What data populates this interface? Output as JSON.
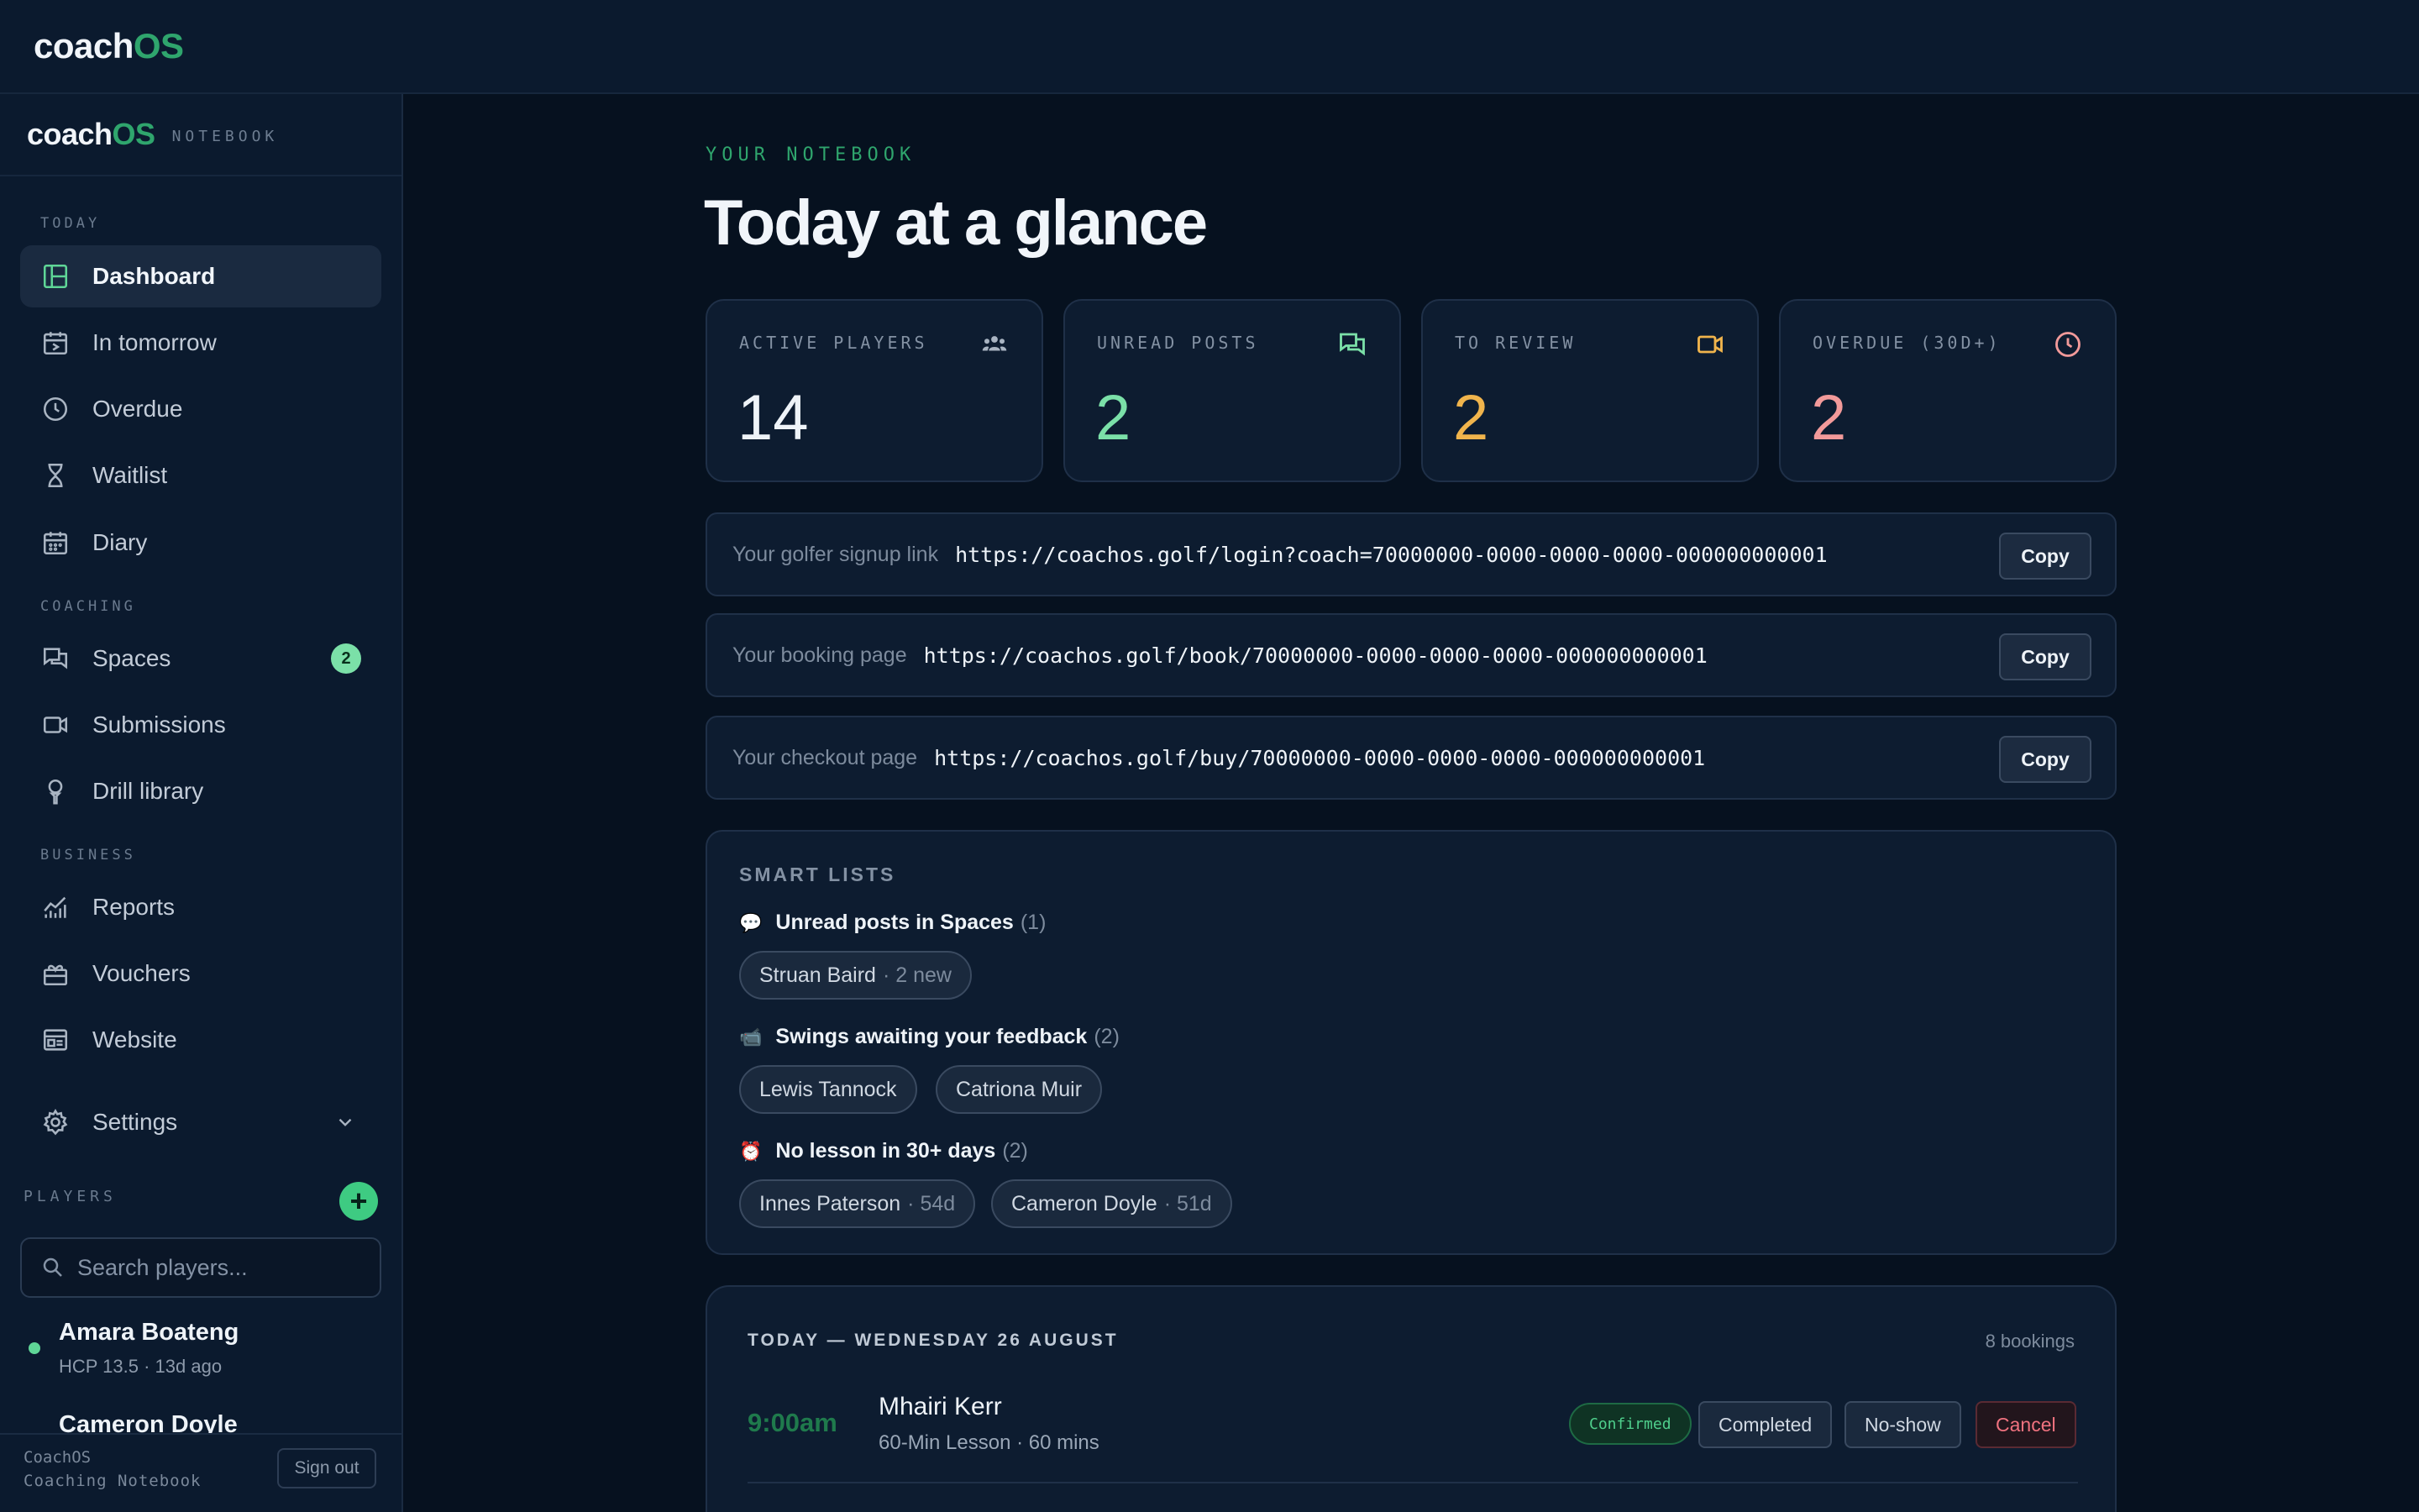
{
  "topbar": {
    "brand_main": "coach",
    "brand_accent": "OS"
  },
  "sidebar": {
    "brand_main": "coach",
    "brand_accent": "OS",
    "brand_tag": "NOTEBOOK",
    "sections": {
      "today": "TODAY",
      "coaching": "COACHING",
      "business": "BUSINESS"
    },
    "items": [
      {
        "label": "Dashboard",
        "icon": "dashboard-icon"
      },
      {
        "label": "In tomorrow",
        "icon": "calendar-arrow-icon"
      },
      {
        "label": "Overdue",
        "icon": "clock-icon"
      },
      {
        "label": "Waitlist",
        "icon": "hourglass-icon"
      },
      {
        "label": "Diary",
        "icon": "calendar-icon"
      },
      {
        "label": "Spaces",
        "icon": "chat-icon",
        "badge": "2"
      },
      {
        "label": "Submissions",
        "icon": "video-icon"
      },
      {
        "label": "Drill library",
        "icon": "golf-tee-icon"
      },
      {
        "label": "Reports",
        "icon": "chart-icon"
      },
      {
        "label": "Vouchers",
        "icon": "gift-icon"
      },
      {
        "label": "Website",
        "icon": "browser-icon"
      },
      {
        "label": "Settings",
        "icon": "gear-icon"
      }
    ],
    "players_label": "PLAYERS",
    "search_placeholder": "Search players...",
    "players": [
      {
        "name": "Amara Boateng",
        "meta": "HCP 13.5 · 13d ago"
      },
      {
        "name": "Cameron Doyle",
        "meta": ""
      }
    ],
    "footer": {
      "line1": "CoachOS",
      "line2": "Coaching Notebook",
      "signout": "Sign out"
    }
  },
  "main": {
    "eyebrow": "YOUR NOTEBOOK",
    "title": "Today at a glance",
    "stats": [
      {
        "label": "ACTIVE PLAYERS",
        "value": "14",
        "icon": "people-icon",
        "color": "#eef3f8"
      },
      {
        "label": "UNREAD POSTS",
        "value": "2",
        "icon": "chat-icon",
        "color": "#7be0a8"
      },
      {
        "label": "TO REVIEW",
        "value": "2",
        "icon": "video-icon",
        "color": "#f0b44c"
      },
      {
        "label": "OVERDUE (30D+)",
        "value": "2",
        "icon": "clock-icon",
        "color": "#f29a9a"
      }
    ],
    "links": [
      {
        "label": "Your golfer signup link",
        "url": "https://coachos.golf/login?coach=70000000-0000-0000-0000-000000000001",
        "button": "Copy"
      },
      {
        "label": "Your booking page",
        "url": "https://coachos.golf/book/70000000-0000-0000-0000-000000000001",
        "button": "Copy"
      },
      {
        "label": "Your checkout page",
        "url": "https://coachos.golf/buy/70000000-0000-0000-0000-000000000001",
        "button": "Copy"
      }
    ],
    "smart_lists": {
      "title": "SMART LISTS",
      "lists": [
        {
          "emoji": "💬",
          "title": "Unread posts in Spaces",
          "count": "(1)",
          "chips": [
            {
              "name": "Struan Baird",
              "sub": "· 2 new"
            }
          ]
        },
        {
          "emoji": "📹",
          "title": "Swings awaiting your feedback",
          "count": "(2)",
          "chips": [
            {
              "name": "Lewis Tannock",
              "sub": ""
            },
            {
              "name": "Catriona Muir",
              "sub": ""
            }
          ]
        },
        {
          "emoji": "⏰",
          "title": "No lesson in 30+ days",
          "count": "(2)",
          "chips": [
            {
              "name": "Innes Paterson",
              "sub": "· 54d"
            },
            {
              "name": "Cameron Doyle",
              "sub": "· 51d"
            }
          ]
        }
      ]
    },
    "today": {
      "heading": "TODAY — WEDNESDAY 26 AUGUST",
      "count": "8 bookings",
      "bookings": [
        {
          "time": "9:00am",
          "name": "Mhairi Kerr",
          "detail": "60-Min Lesson · 60 mins",
          "status": "Confirmed",
          "actions": [
            "Completed",
            "No-show",
            "Cancel"
          ]
        }
      ]
    }
  }
}
